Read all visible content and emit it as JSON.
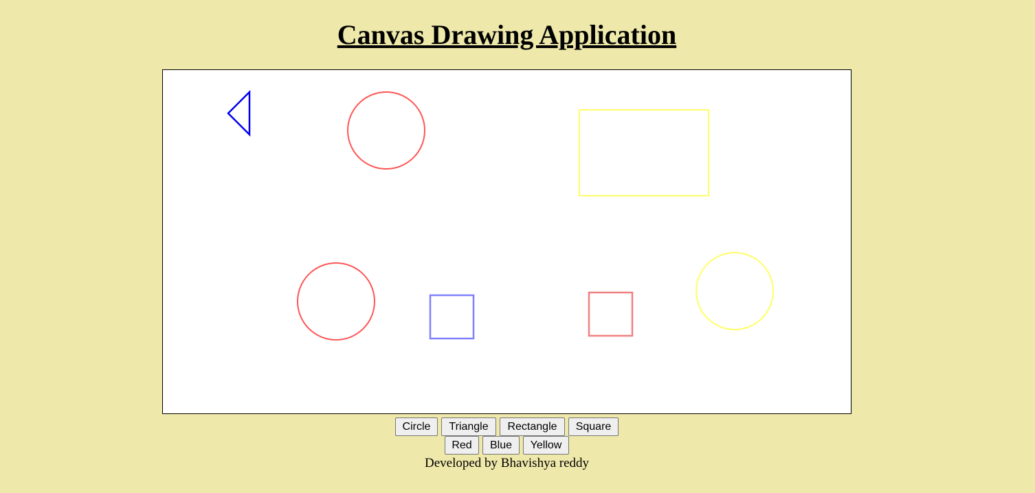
{
  "header": {
    "title": "Canvas Drawing Application"
  },
  "shape_buttons": [
    "Circle",
    "Triangle",
    "Rectangle",
    "Square"
  ],
  "color_buttons": [
    "Red",
    "Blue",
    "Yellow"
  ],
  "footer": {
    "text": "Developed by Bhavishya reddy"
  },
  "colors": {
    "background": "#EEE8AA",
    "canvas": "#FFFFFF",
    "red": "#FF5555",
    "blue": "#0000EE",
    "light_blue": "#8080FF",
    "yellow": "#FFFF66"
  }
}
